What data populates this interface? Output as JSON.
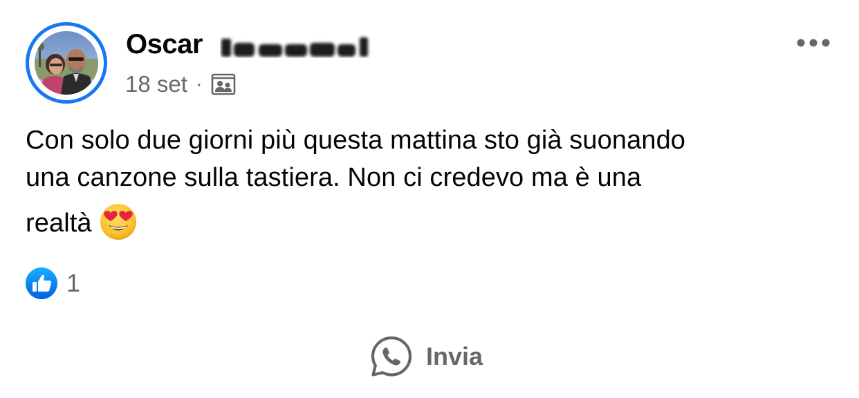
{
  "post": {
    "author_first_name": "Oscar",
    "date": "18 set",
    "separator": "·",
    "audience_icon": "photo-album-icon",
    "text_lines": [
      "Con solo due giorni più questa mattina sto già suonando",
      "una canzone sulla tastiera. Non ci credevo ma è una",
      "realtà"
    ],
    "emoji": "smiling-face-with-heart-eyes-emoji"
  },
  "reactions": {
    "icon": "like-icon",
    "count": "1"
  },
  "actions": {
    "send_icon": "whatsapp-icon",
    "send_label": "Invia"
  },
  "colors": {
    "accent": "#1877f2",
    "secondary_text": "#65676b",
    "primary_text": "#050505"
  }
}
